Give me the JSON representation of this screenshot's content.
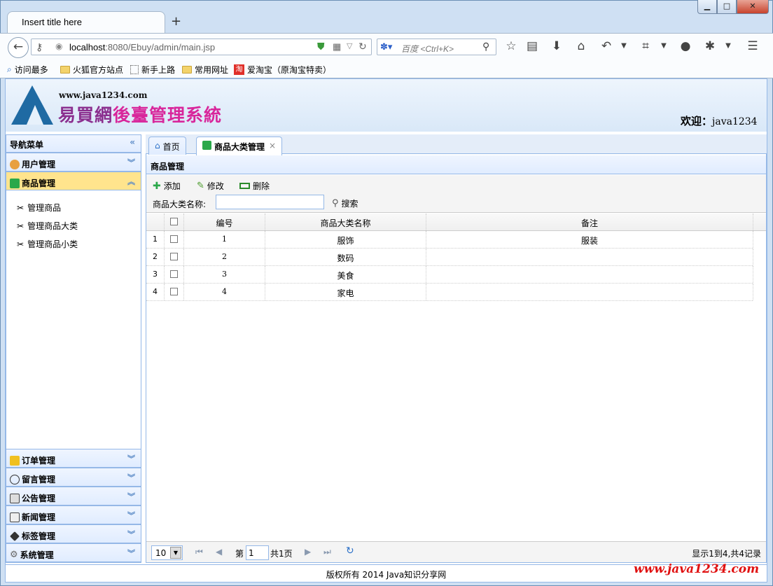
{
  "browser": {
    "tab_title": "Insert title here",
    "new_tab": "+",
    "url_host": "localhost",
    "url_path": ":8080/Ebuy/admin/main.jsp",
    "search_placeholder": "百度 <Ctrl+K>",
    "bookmarks": [
      "访问最多",
      "火狐官方站点",
      "新手上路",
      "常用网址",
      "爱淘宝（原淘宝特卖）"
    ]
  },
  "header": {
    "site_url": "www.java1234.com",
    "system_title_a": "易買網",
    "system_title_b": "後臺管理系統",
    "welcome_label": "欢迎：",
    "username": "java1234"
  },
  "sidebar": {
    "title": "导航菜单",
    "groups": [
      {
        "label": "用户管理",
        "icon": "users-icon"
      },
      {
        "label": "商品管理",
        "icon": "list-icon"
      },
      {
        "label": "订单管理",
        "icon": "order-icon"
      },
      {
        "label": "留言管理",
        "icon": "speech-bubble-icon"
      },
      {
        "label": "公告管理",
        "icon": "notice-icon"
      },
      {
        "label": "新闻管理",
        "icon": "news-icon"
      },
      {
        "label": "标签管理",
        "icon": "tag-icon"
      },
      {
        "label": "系统管理",
        "icon": "gear-icon"
      }
    ],
    "subitems": [
      "管理商品",
      "管理商品大类",
      "管理商品小类"
    ]
  },
  "tabs": [
    {
      "label": "首页"
    },
    {
      "label": "商品大类管理"
    }
  ],
  "panel": {
    "title": "商品管理",
    "add": "添加",
    "edit": "修改",
    "delete": "删除",
    "filter_label": "商品大类名称:",
    "filter_value": "",
    "search": "搜索"
  },
  "table": {
    "columns": [
      "编号",
      "商品大类名称",
      "备注"
    ],
    "rows": [
      {
        "n": "1",
        "id": "1",
        "name": "服饰",
        "remark": "服装"
      },
      {
        "n": "2",
        "id": "2",
        "name": "数码",
        "remark": ""
      },
      {
        "n": "3",
        "id": "3",
        "name": "美食",
        "remark": ""
      },
      {
        "n": "4",
        "id": "4",
        "name": "家电",
        "remark": ""
      }
    ]
  },
  "pager": {
    "page_size": "10",
    "page_prefix": "第",
    "page_value": "1",
    "page_total": "共1页",
    "summary": "显示1到4,共4记录"
  },
  "footer": {
    "copyright": "版权所有 2014 Java知识分享网",
    "url": "www.java1234.com"
  },
  "colors": {
    "accent": "#95b8e7",
    "selected": "#ffe48d",
    "brand_red": "#e01010"
  }
}
